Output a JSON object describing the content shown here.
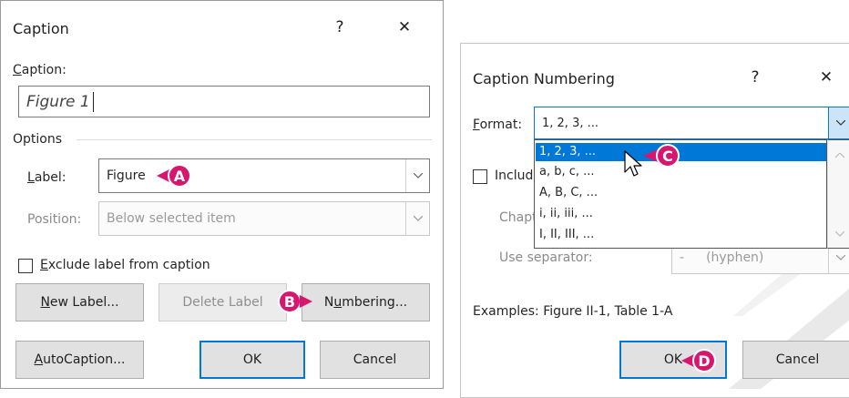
{
  "caption_dialog": {
    "title": "Caption",
    "help_glyph": "?",
    "close_glyph": "✕",
    "caption_label_pre": "",
    "caption_label_u": "C",
    "caption_label_post": "aption:",
    "caption_value": "Figure 1",
    "options_label": "Options",
    "label_label_u": "L",
    "label_label_post": "abel:",
    "label_value": "Figure",
    "position_label": "Position:",
    "position_value": "Below selected item",
    "exclude_pre": "",
    "exclude_u": "E",
    "exclude_post": "xclude label from caption",
    "new_label_u": "N",
    "new_label_post": "ew Label...",
    "delete_label": "Delete Label",
    "numbering_pre": "N",
    "numbering_u": "u",
    "numbering_post": "mbering...",
    "autocaption_u": "A",
    "autocaption_post": "utoCaption...",
    "ok": "OK",
    "cancel": "Cancel"
  },
  "numbering_dialog": {
    "title": "Caption Numbering",
    "help_glyph": "?",
    "close_glyph": "✕",
    "format_u": "F",
    "format_post": "ormat:",
    "format_value": "1, 2, 3, ...",
    "format_options": [
      "1, 2, 3, ...",
      "a, b, c, ...",
      "A, B, C, ...",
      "i, ii, iii, ...",
      "I, II, III, ..."
    ],
    "include_label": "Includ",
    "chapter_label": "Chapt",
    "separator_label": "Use separator:",
    "separator_value": "-",
    "separator_desc": "(hyphen)",
    "examples": "Examples:  Figure II-1, Table 1-A",
    "ok": "OK",
    "cancel": "Cancel"
  },
  "callouts": {
    "a": "A",
    "b": "B",
    "c": "C",
    "d": "D"
  },
  "colors": {
    "callout": "#d6166f",
    "selection": "#0078d7"
  }
}
